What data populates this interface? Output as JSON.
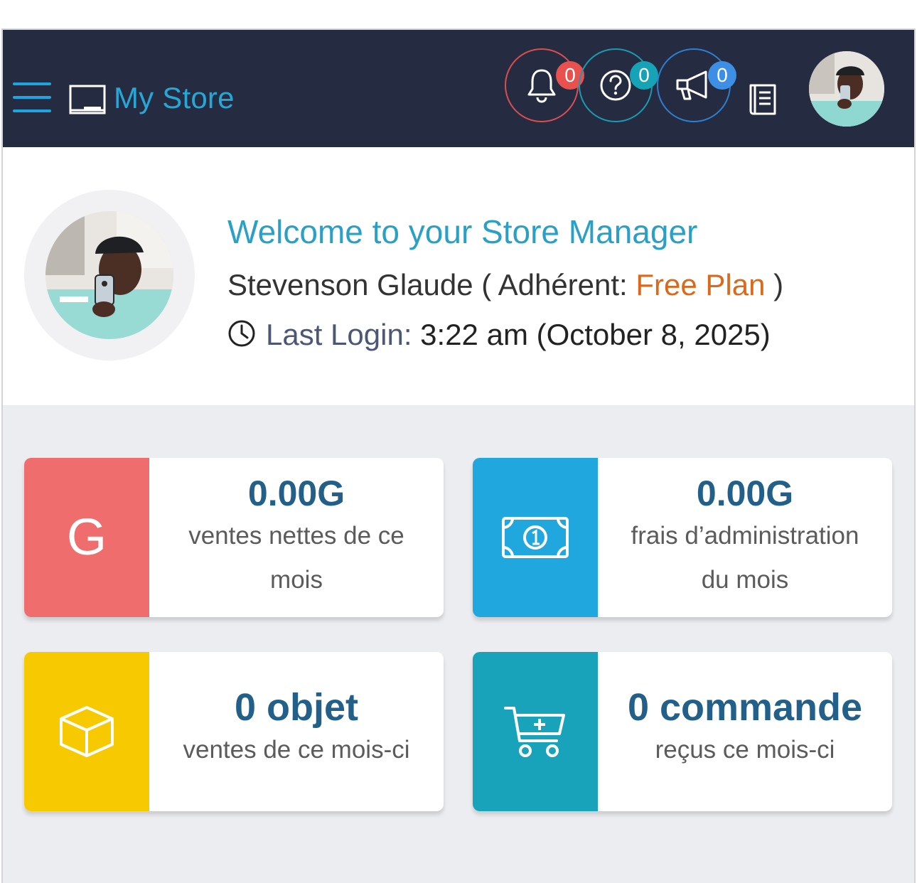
{
  "header": {
    "store_title": "My Store",
    "notifications_count": "0",
    "help_count": "0",
    "announcements_count": "0"
  },
  "welcome": {
    "title": "Welcome to your Store Manager",
    "user_name": "Stevenson Glaude",
    "membership_label": "( Adhérent:",
    "plan": "Free Plan",
    "membership_close": ")",
    "last_login_label": "Last Login:",
    "last_login_value": "3:22 am (October 8, 2025)"
  },
  "cards": [
    {
      "icon": "G",
      "value": "0.00G",
      "desc_line1": "ventes nettes de ce",
      "desc_line2": "mois",
      "color": "#f06d6e"
    },
    {
      "icon": "money-bill-icon",
      "value": "0.00G",
      "desc_line1": "frais d’administration",
      "desc_line2": "du mois",
      "color": "#20a7dd"
    },
    {
      "icon": "cube-icon",
      "value": "0 objet",
      "desc_line1": "ventes de ce mois-ci",
      "color": "#f7c900"
    },
    {
      "icon": "cart-plus-icon",
      "value": "0 commande",
      "desc_line1": "reçus ce mois-ci",
      "color": "#18a3bb"
    }
  ],
  "colors": {
    "header_bg": "#252b40",
    "accent": "#26a7d6",
    "plan": "#d9691b",
    "value_text": "#22608a"
  }
}
